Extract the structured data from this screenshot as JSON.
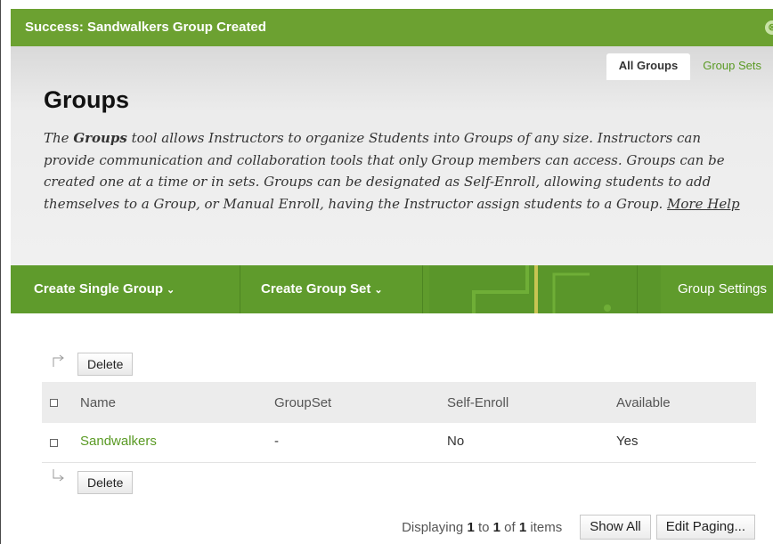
{
  "success": {
    "message": "Success: Sandwalkers Group Created",
    "close_icon": "⊗"
  },
  "tabs": [
    {
      "label": "All Groups"
    },
    {
      "label": "Group Sets"
    }
  ],
  "page": {
    "title": "Groups",
    "desc_before": "The ",
    "desc_bold": "Groups",
    "desc_after": " tool allows Instructors to organize Students into Groups of any size. Instructors can provide communication and collaboration tools that only Group members can access. Groups can be created one at a time or in sets. Groups can be designated as Self-Enroll, allowing students to add themselves to a Group, or Manual Enroll, having the Instructor assign students to a Group. ",
    "more_help": "More Help"
  },
  "actionbar": {
    "create_single": "Create Single Group",
    "create_set": "Create Group Set",
    "settings": "Group Settings",
    "caret": "⌄",
    "colors": {
      "bar": "#5f9b2c",
      "accent": "#6ca131"
    }
  },
  "list": {
    "delete_top": "Delete",
    "delete_bottom": "Delete",
    "columns": [
      "Name",
      "GroupSet",
      "Self-Enroll",
      "Available"
    ],
    "rows": [
      {
        "name": "Sandwalkers",
        "groupset": "-",
        "self_enroll": "No",
        "available": "Yes"
      }
    ]
  },
  "pager": {
    "prefix": "Displaying ",
    "from": "1",
    "to_word": " to ",
    "to": "1",
    "of_word": " of ",
    "total": "1",
    "suffix": " items",
    "show_all": "Show All",
    "edit_paging": "Edit Paging..."
  }
}
